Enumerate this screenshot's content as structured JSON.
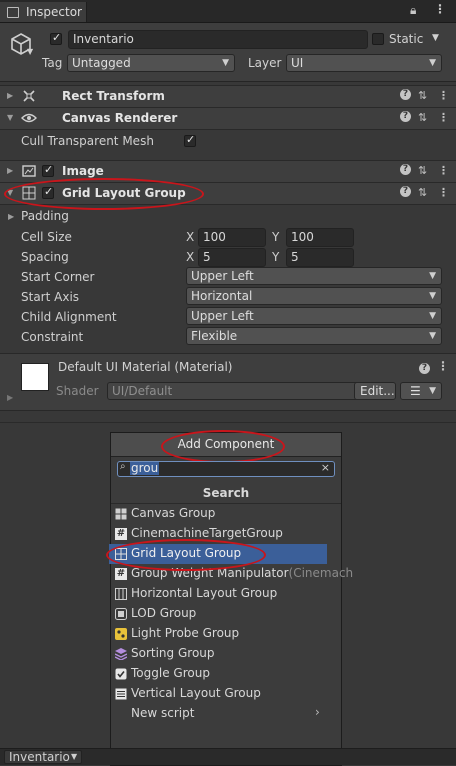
{
  "window": {
    "tab_label": "Inspector"
  },
  "object": {
    "name": "Inventario",
    "static_label": "Static",
    "tag_label": "Tag",
    "tag_value": "Untagged",
    "layer_label": "Layer",
    "layer_value": "UI"
  },
  "components": {
    "rect_transform": "Rect Transform",
    "canvas_renderer": "Canvas Renderer",
    "cull_label": "Cull Transparent Mesh",
    "image": "Image",
    "grid_layout": "Grid Layout Group"
  },
  "grid": {
    "padding": "Padding",
    "cell_size_label": "Cell Size",
    "cell_x": "100",
    "cell_y": "100",
    "spacing_label": "Spacing",
    "spacing_x": "5",
    "spacing_y": "5",
    "x_label": "X",
    "y_label": "Y",
    "start_corner_label": "Start Corner",
    "start_corner": "Upper Left",
    "start_axis_label": "Start Axis",
    "start_axis": "Horizontal",
    "child_alignment_label": "Child Alignment",
    "child_alignment": "Upper Left",
    "constraint_label": "Constraint",
    "constraint": "Flexible"
  },
  "material": {
    "name": "Default UI Material (Material)",
    "shader_label": "Shader",
    "shader_value": "UI/Default",
    "edit_label": "Edit..."
  },
  "add_component": {
    "button_label": "Add Component",
    "search_value": "grou",
    "section_title": "Search",
    "results": [
      {
        "label": "Canvas Group",
        "icon": "canvas-group-icon"
      },
      {
        "label": "CinemachineTargetGroup",
        "icon": "script-hash-icon"
      },
      {
        "label": "Grid Layout Group",
        "icon": "grid-layout-icon"
      },
      {
        "label": "Group Weight Manipulator",
        "suffix": "(Cinemach",
        "icon": "script-hash-icon"
      },
      {
        "label": "Horizontal Layout Group",
        "icon": "horizontal-layout-icon"
      },
      {
        "label": "LOD Group",
        "icon": "lod-group-icon"
      },
      {
        "label": "Light Probe Group",
        "icon": "light-probe-icon"
      },
      {
        "label": "Sorting Group",
        "icon": "sorting-group-icon"
      },
      {
        "label": "Toggle Group",
        "icon": "toggle-group-icon"
      },
      {
        "label": "Vertical Layout Group",
        "icon": "vertical-layout-icon"
      }
    ],
    "new_script": "New script"
  },
  "bottom": {
    "object_label": "Inventario"
  },
  "colors": {
    "selection": "#3b5f99",
    "annotation": "#c9151b"
  }
}
